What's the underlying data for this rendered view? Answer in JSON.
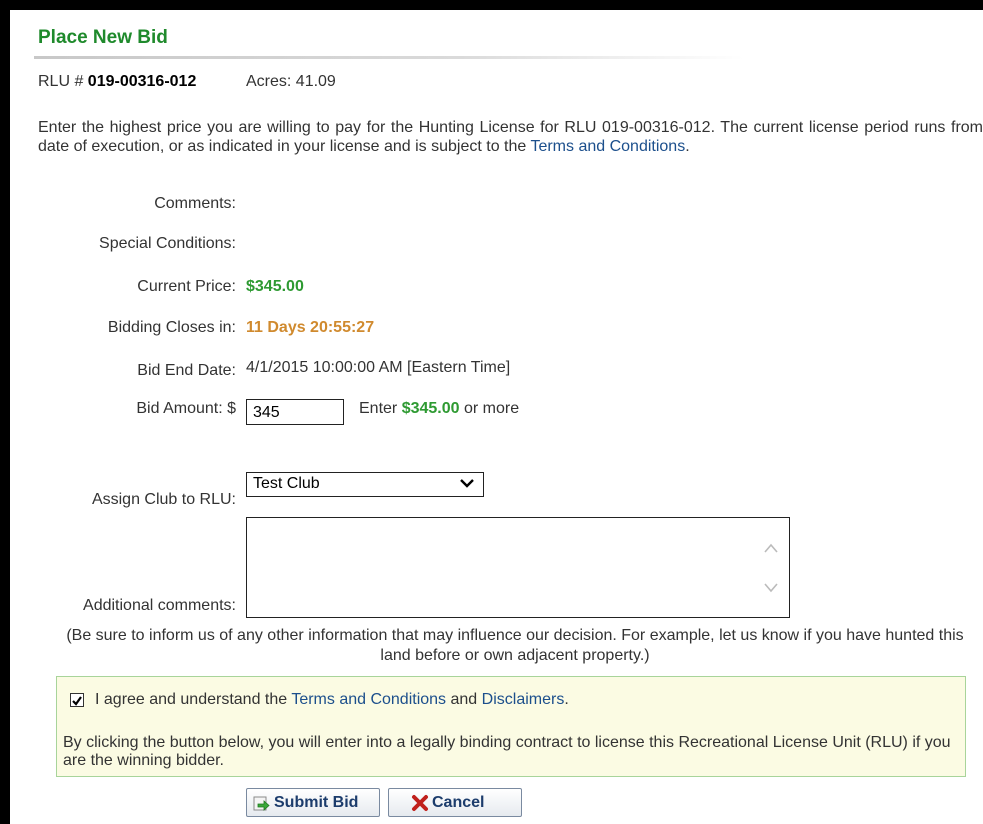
{
  "header": {
    "title": "Place New Bid"
  },
  "rlu": {
    "prefix": "RLU # ",
    "number": "019-00316-012",
    "acres": "Acres: 41.09"
  },
  "intro": {
    "text": "Enter the highest price you are willing to pay for the Hunting License for RLU 019-00316-012. The current license period runs from date of execution, or as indicated in your license and is subject to the ",
    "link": "Terms and Conditions",
    "end": "."
  },
  "fields": {
    "comments_label": "Comments:",
    "special_label": "Special Conditions:",
    "price_label": "Current Price:",
    "price_value": "$345.00",
    "closes_label": "Bidding Closes in:",
    "closes_value": "11 Days 20:55:27",
    "end_label": "Bid End Date:",
    "end_value": "4/1/2015 10:00:00 AM [Eastern Time]",
    "amount_label": "Bid Amount: $",
    "amount_value": "345",
    "enter_prefix": "Enter ",
    "enter_amount": "$345.00",
    "enter_suffix": " or more",
    "club_label": "Assign Club to RLU:",
    "club_selected": "Test Club",
    "additional_label": "Additional comments:"
  },
  "note": "(Be sure to inform us of any other information that may influence our decision. For example, let us know if you have hunted this land before or own adjacent property.)",
  "agreement": {
    "checked": true,
    "text_prefix": "I agree and understand the ",
    "terms_link": "Terms and Conditions",
    "and": " and ",
    "disclaimers_link": "Disclaimers",
    "text_suffix": ".",
    "legal": "By clicking the button below, you will enter into a legally binding contract to license this Recreational License Unit (RLU) if you are the winning bidder."
  },
  "buttons": {
    "submit": "Submit Bid",
    "cancel": "Cancel"
  },
  "colors": {
    "title_green": "#1f8a2c",
    "price_green": "#2e9a32",
    "countdown_orange": "#d08a2e",
    "link_blue": "#1c4f8c",
    "cancel_red": "#c0201c"
  },
  "icons": {
    "submit": "arrow-right-page-icon",
    "cancel": "red-x-icon",
    "checkbox": "checkmark-icon",
    "select": "chevron-down-icon"
  }
}
